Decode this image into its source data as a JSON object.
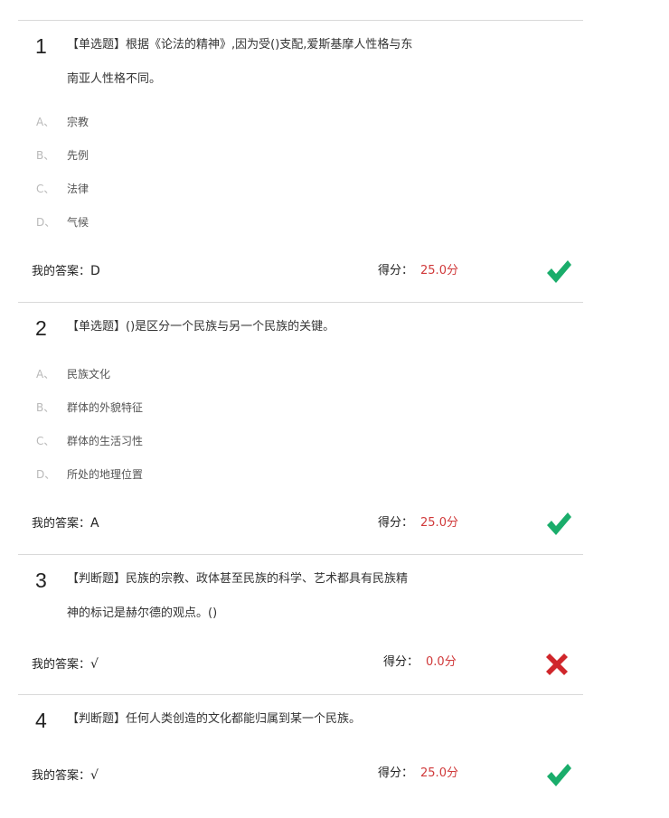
{
  "questions": [
    {
      "number": "1",
      "text_line1": "【单选题】根据《论法的精神》,因为受()支配,爱斯基摩人性格与东",
      "text_line2": "南亚人性格不同。",
      "options": [
        {
          "letter": "A、",
          "text": "宗教"
        },
        {
          "letter": "B、",
          "text": "先例"
        },
        {
          "letter": "C、",
          "text": "法律"
        },
        {
          "letter": "D、",
          "text": "气候"
        }
      ],
      "answer_label": "我的答案：",
      "answer": "D",
      "score_label": "得分：",
      "score": "25.0分",
      "result_icon": "check-icon"
    },
    {
      "number": "2",
      "text_line1": "【单选题】()是区分一个民族与另一个民族的关键。",
      "options": [
        {
          "letter": "A、",
          "text": "民族文化"
        },
        {
          "letter": "B、",
          "text": "群体的外貌特征"
        },
        {
          "letter": "C、",
          "text": "群体的生活习性"
        },
        {
          "letter": "D、",
          "text": "所处的地理位置"
        }
      ],
      "answer_label": "我的答案：",
      "answer": "A",
      "score_label": "得分：",
      "score": "25.0分",
      "result_icon": "check-icon"
    },
    {
      "number": "3",
      "text_line1": "【判断题】民族的宗教、政体甚至民族的科学、艺术都具有民族精",
      "text_line2": "神的标记是赫尔德的观点。()",
      "answer_label": "我的答案：",
      "answer": "√",
      "score_label": "得分：",
      "score": "0.0分",
      "result_icon": "cross-icon"
    },
    {
      "number": "4",
      "text_line1": "【判断题】任何人类创造的文化都能归属到某一个民族。",
      "answer_label": "我的答案：",
      "answer": "√",
      "score_label": "得分：",
      "score": "25.0分",
      "result_icon": "check-icon"
    }
  ],
  "colors": {
    "correct": "#1aad6b",
    "wrong": "#d0262b",
    "score": "#d0393a",
    "option_letter": "#b9b9b9"
  }
}
